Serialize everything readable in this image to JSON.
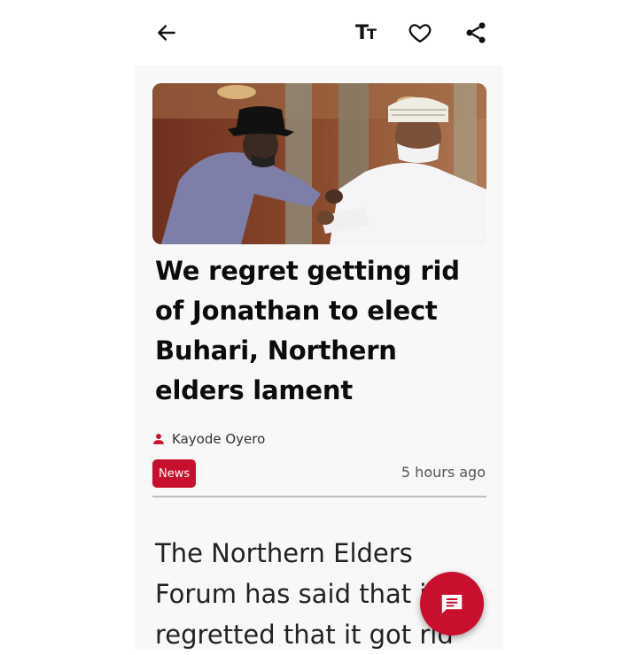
{
  "article": {
    "headline": "We regret getting rid of Jonathan to elect Buhari, Northern elders lament",
    "author": "Kayode Oyero",
    "tag": "News",
    "time": "5 hours ago",
    "body": "The Northern Elders Forum has said that it regretted that it got rid"
  },
  "toolbar": {
    "back_icon": "arrow-left-icon",
    "text_size_icon": "text-size-icon",
    "favorite_icon": "heart-icon",
    "share_icon": "share-icon",
    "text_size_glyph": "TT"
  },
  "fab": {
    "icon": "comment-icon"
  },
  "colors": {
    "accent": "#c8102e",
    "card_bg": "#f8f8f8"
  }
}
